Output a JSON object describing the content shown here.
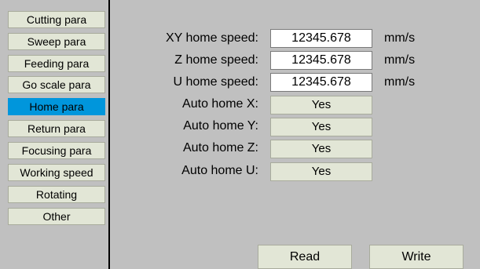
{
  "sidebar": {
    "items": [
      {
        "label": "Cutting para"
      },
      {
        "label": "Sweep para"
      },
      {
        "label": "Feeding para"
      },
      {
        "label": "Go scale para"
      },
      {
        "label": "Home para",
        "active": true
      },
      {
        "label": "Return para"
      },
      {
        "label": "Focusing para"
      },
      {
        "label": "Working speed"
      },
      {
        "label": "Rotating"
      },
      {
        "label": "Other"
      }
    ]
  },
  "speeds": [
    {
      "label": "XY home speed:",
      "value": "12345.678",
      "unit": "mm/s"
    },
    {
      "label": "Z home speed:",
      "value": "12345.678",
      "unit": "mm/s"
    },
    {
      "label": "U home speed:",
      "value": "12345.678",
      "unit": "mm/s"
    }
  ],
  "auto_home": [
    {
      "label": "Auto home X:",
      "value": "Yes"
    },
    {
      "label": "Auto home Y:",
      "value": "Yes"
    },
    {
      "label": "Auto home Z:",
      "value": "Yes"
    },
    {
      "label": "Auto home U:",
      "value": "Yes"
    }
  ],
  "actions": {
    "read_label": "Read",
    "write_label": "Write"
  },
  "colors": {
    "background": "#c0c0c0",
    "button": "#e2e6d6",
    "active_item": "#0096dc",
    "input": "#ffffff"
  }
}
